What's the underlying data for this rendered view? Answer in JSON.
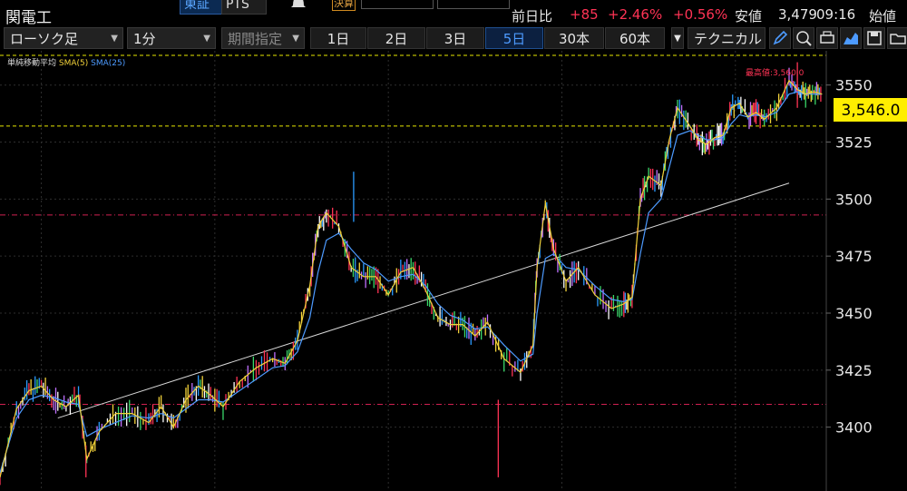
{
  "header": {
    "symbol": "関電工",
    "exchanges": [
      "東証",
      "PTS"
    ],
    "flag": "決算",
    "quote": {
      "change_label": "前日比",
      "change": "+85",
      "change_pct": "+2.46%",
      "extra_pct": "+0.56%",
      "low_label": "安値",
      "low_value": "3,479",
      "time": "09:16",
      "open_label": "始値"
    }
  },
  "toolbar": {
    "chart_type": "ローソク足",
    "interval": "1分",
    "period": "期間指定",
    "timeframes": [
      "1日",
      "2日",
      "3日",
      "5日",
      "30本",
      "60本"
    ],
    "selected_timeframe": "5日",
    "technical": "テクニカル",
    "icons": [
      "pencil-icon",
      "zoom-icon",
      "print-icon",
      "chart-area-icon",
      "save-icon",
      "folder-icon"
    ]
  },
  "legend": {
    "title": "単純移動平均",
    "sma5": "SMA(5)",
    "sma25": "SMA(25)"
  },
  "colors": {
    "accent_blue": "#4d9bff",
    "up_red": "#ff3355",
    "sma5": "#f2d23a",
    "sma25": "#4d9bff",
    "level_yellow": "#e6e600",
    "level_red": "#d02050",
    "price_tag_bg": "#ffee00"
  },
  "chart_data": {
    "type": "line",
    "ylim": [
      3372,
      3565
    ],
    "yticks": [
      "3400",
      "3425",
      "3450",
      "3475",
      "3500",
      "3525",
      "3550"
    ],
    "last_price_label": "3,546.0",
    "high_annotation": "最高値:3,560.0",
    "high_value": 3560,
    "levels": {
      "yellow": [
        3563,
        3532
      ],
      "red": [
        3493,
        3410
      ]
    },
    "trendline": {
      "x": [
        0.07,
        0.955
      ],
      "y": [
        3404,
        3507
      ]
    },
    "x": [
      0.0,
      0.02,
      0.035,
      0.05,
      0.065,
      0.08,
      0.095,
      0.105,
      0.12,
      0.14,
      0.16,
      0.18,
      0.195,
      0.21,
      0.225,
      0.24,
      0.255,
      0.27,
      0.29,
      0.31,
      0.33,
      0.345,
      0.36,
      0.375,
      0.385,
      0.395,
      0.41,
      0.425,
      0.44,
      0.455,
      0.47,
      0.485,
      0.5,
      0.515,
      0.53,
      0.545,
      0.56,
      0.575,
      0.59,
      0.61,
      0.63,
      0.645,
      0.65,
      0.66,
      0.67,
      0.685,
      0.7,
      0.72,
      0.74,
      0.755,
      0.765,
      0.775,
      0.785,
      0.8,
      0.81,
      0.82,
      0.835,
      0.845,
      0.855,
      0.865,
      0.875,
      0.885,
      0.895,
      0.905,
      0.915,
      0.925,
      0.94,
      0.955,
      0.965,
      0.975,
      0.985,
      0.995
    ],
    "series": [
      {
        "name": "SMA(5)",
        "values": [
          3378,
          3408,
          3416,
          3418,
          3412,
          3409,
          3414,
          3386,
          3398,
          3406,
          3406,
          3402,
          3409,
          3400,
          3412,
          3418,
          3414,
          3409,
          3420,
          3426,
          3430,
          3428,
          3438,
          3462,
          3488,
          3494,
          3488,
          3470,
          3466,
          3466,
          3458,
          3468,
          3470,
          3460,
          3448,
          3445,
          3445,
          3440,
          3446,
          3430,
          3424,
          3436,
          3470,
          3498,
          3478,
          3464,
          3470,
          3458,
          3452,
          3454,
          3457,
          3500,
          3510,
          3506,
          3526,
          3540,
          3532,
          3526,
          3524,
          3527,
          3528,
          3540,
          3542,
          3536,
          3538,
          3535,
          3540,
          3552,
          3548,
          3546,
          3547,
          3546
        ]
      },
      {
        "name": "SMA(25)",
        "values": [
          3380,
          3404,
          3412,
          3414,
          3413,
          3411,
          3410,
          3396,
          3399,
          3402,
          3405,
          3404,
          3406,
          3404,
          3408,
          3412,
          3412,
          3411,
          3416,
          3421,
          3426,
          3427,
          3433,
          3448,
          3468,
          3482,
          3485,
          3478,
          3472,
          3469,
          3464,
          3466,
          3467,
          3462,
          3454,
          3449,
          3447,
          3443,
          3444,
          3436,
          3429,
          3432,
          3450,
          3474,
          3476,
          3470,
          3469,
          3462,
          3456,
          3455,
          3456,
          3476,
          3494,
          3500,
          3514,
          3528,
          3530,
          3528,
          3526,
          3526,
          3527,
          3533,
          3537,
          3536,
          3537,
          3536,
          3538,
          3546,
          3547,
          3546,
          3546,
          3546
        ]
      }
    ]
  }
}
